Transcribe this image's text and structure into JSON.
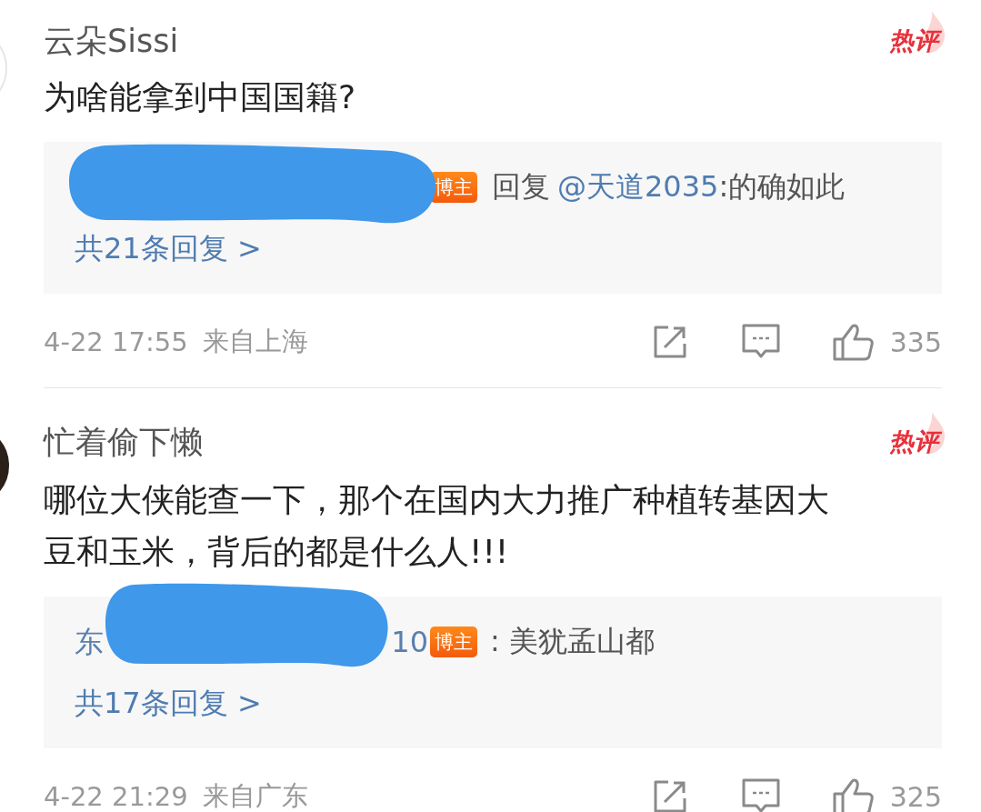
{
  "comments": [
    {
      "avatar": {
        "kind": "light"
      },
      "username": "云朵Sissi",
      "hot_label": "热评",
      "text": "为啥能拿到中国国籍?",
      "reply": {
        "redacted": true,
        "badge": "博主",
        "prefix": "回复",
        "mention": "@天道2035",
        "text": ":的确如此"
      },
      "reply_count": "共21条回复 >",
      "time": "4-22 17:55",
      "location": "来自上海",
      "likes": "335"
    },
    {
      "avatar": {
        "kind": "dark"
      },
      "username": "忙着偷下懒",
      "hot_label": "热评",
      "text": "哪位大侠能查一下，那个在国内大力推广种植转基因大豆和玉米，背后的都是什么人!!!",
      "reply": {
        "redacted": true,
        "name_start": "东",
        "name_end": "10",
        "badge": "博主",
        "text": ": 美犹孟山都"
      },
      "reply_count": "共17条回复 >",
      "time": "4-22 21:29",
      "location": "来自广东",
      "likes": "325"
    }
  ]
}
